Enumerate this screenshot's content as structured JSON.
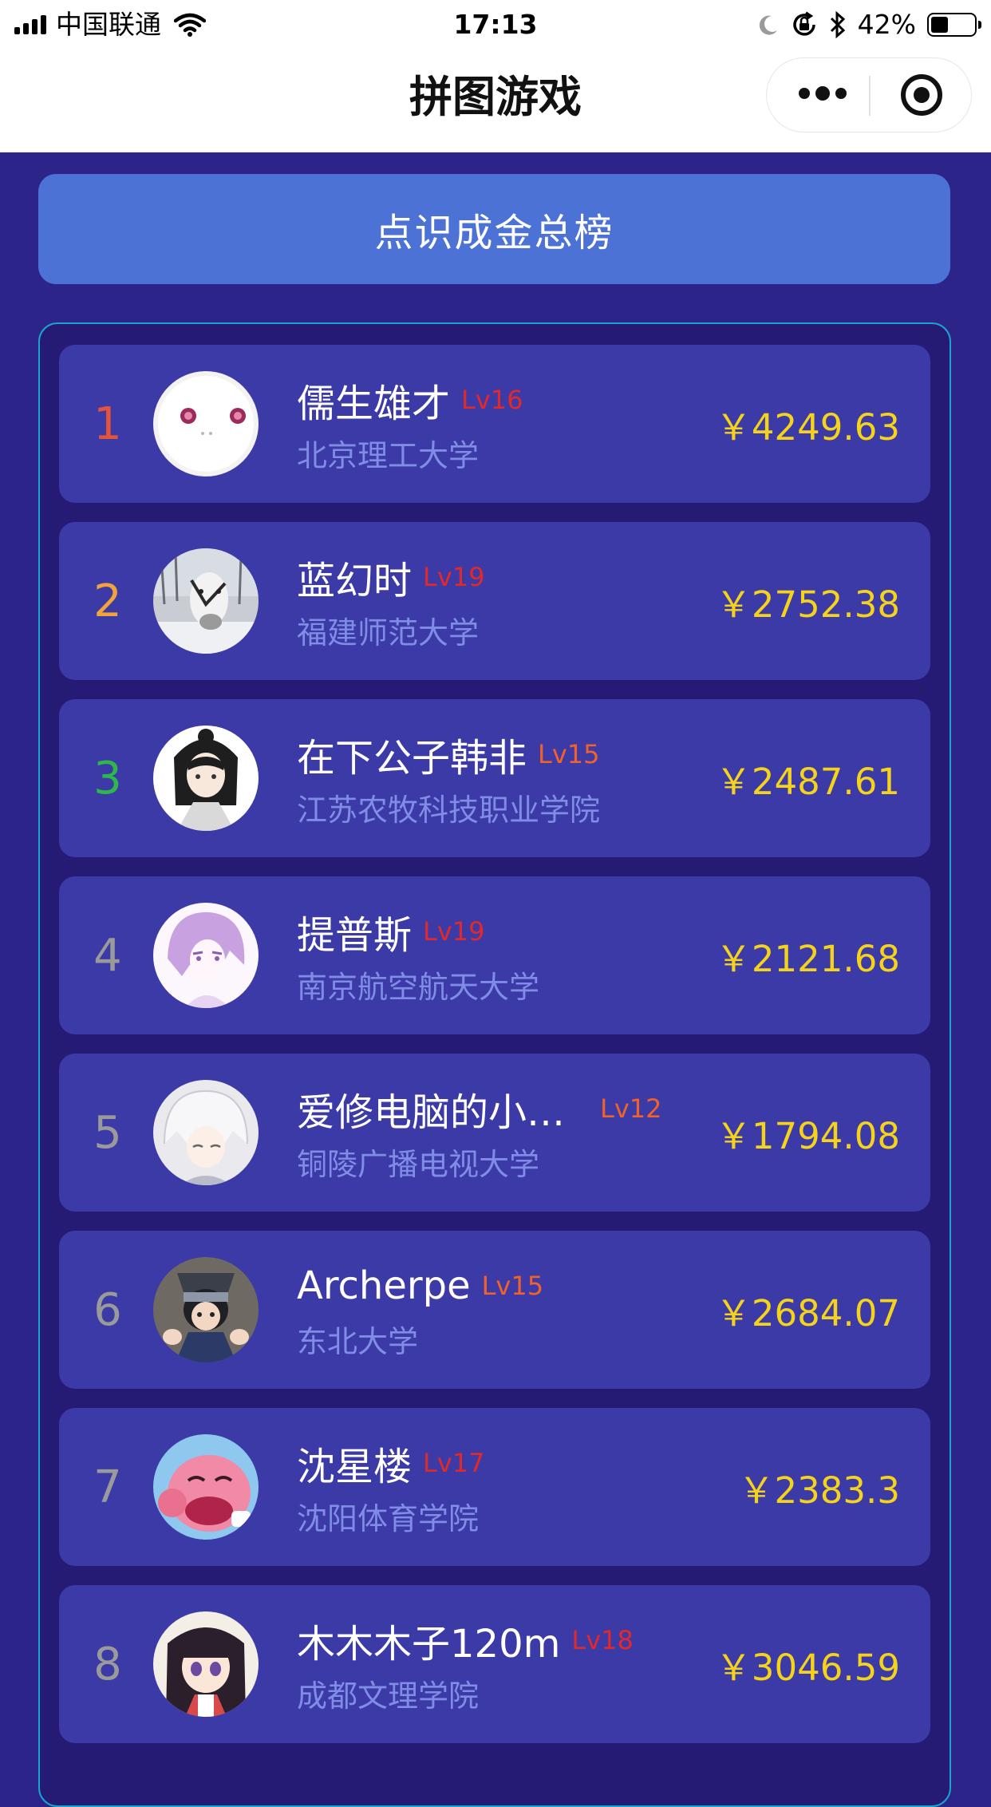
{
  "status_bar": {
    "carrier": "中国联通",
    "time": "17:13",
    "battery": "42%",
    "battery_level": 0.42
  },
  "nav": {
    "title": "拼图游戏"
  },
  "board": {
    "title": "点识成金总榜"
  },
  "rows": [
    {
      "rank": "1",
      "rank_color": "#e5533a",
      "name": "儒生雄才",
      "level": "Lv16",
      "level_color": "#e02a2a",
      "school": "北京理工大学",
      "amount": "￥4249.63",
      "avatar": "white-face-avatar"
    },
    {
      "rank": "2",
      "rank_color": "#f2a33a",
      "name": "蓝幻时",
      "level": "Lv19",
      "level_color": "#e02a2a",
      "school": "福建师范大学",
      "amount": "￥2752.38",
      "avatar": "horse-avatar"
    },
    {
      "rank": "3",
      "rank_color": "#2fb84a",
      "name": "在下公子韩非",
      "level": "Lv15",
      "level_color": "#f0622a",
      "school": "江苏农牧科技职业学院",
      "amount": "￥2487.61",
      "avatar": "anime-scholar-avatar"
    },
    {
      "rank": "4",
      "rank_color": "#9a9a9a",
      "name": "提普斯",
      "level": "Lv19",
      "level_color": "#e02a2a",
      "school": "南京航空航天大学",
      "amount": "￥2121.68",
      "avatar": "purple-hair-avatar"
    },
    {
      "rank": "5",
      "rank_color": "#9a9a9a",
      "name": "爱修电脑的小…",
      "level": "Lv12",
      "level_color": "#f0622a",
      "school": "铜陵广播电视大学",
      "amount": "￥1794.08",
      "avatar": "silver-hair-avatar"
    },
    {
      "rank": "6",
      "rank_color": "#9a9a9a",
      "name": "Archerpe",
      "level": "Lv15",
      "level_color": "#f0622a",
      "school": "东北大学",
      "amount": "￥2684.07",
      "avatar": "ninja-avatar"
    },
    {
      "rank": "7",
      "rank_color": "#9a9a9a",
      "name": "沈星楼",
      "level": "Lv17",
      "level_color": "#e02a2a",
      "school": "沈阳体育学院",
      "amount": "￥2383.3",
      "avatar": "pink-creature-avatar"
    },
    {
      "rank": "8",
      "rank_color": "#9a9a9a",
      "name": "木木木子120m",
      "level": "Lv18",
      "level_color": "#e02a2a",
      "school": "成都文理学院",
      "amount": "￥3046.59",
      "avatar": "anime-girl-avatar"
    }
  ],
  "colors": {
    "background": "#2d2489",
    "banner": "#4d72d6",
    "row": "#3c3aa6",
    "amount": "#f5d31a",
    "school": "#7f8de6"
  }
}
